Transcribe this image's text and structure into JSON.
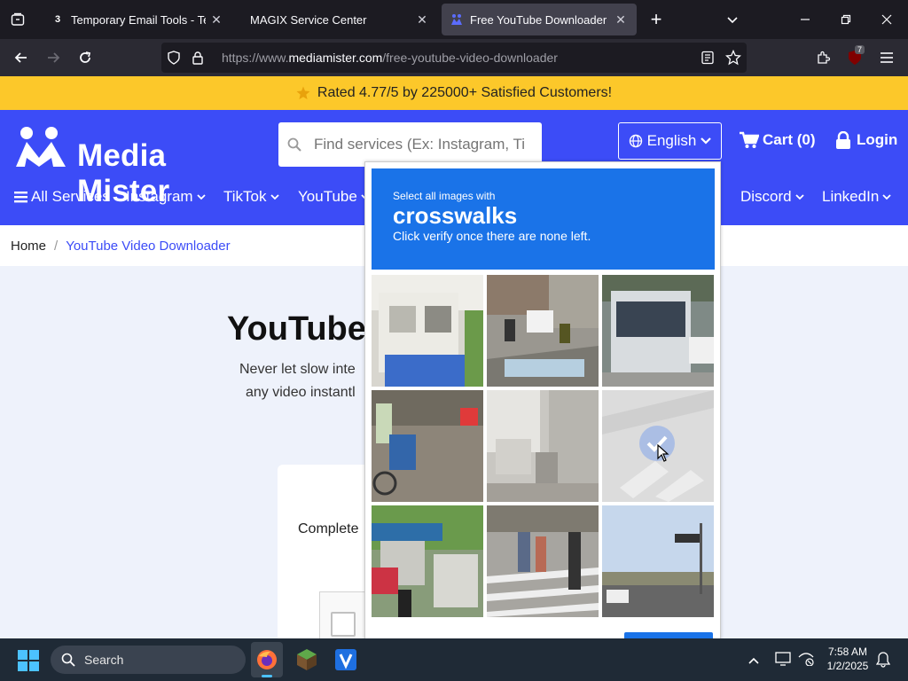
{
  "browser": {
    "tabs": [
      {
        "title": "Temporary Email Tools - Tempo",
        "favicon": "temp-mail-favicon",
        "active": false
      },
      {
        "title": "MAGIX Service Center",
        "favicon": "magix-favicon",
        "active": false
      },
      {
        "title": "Free YouTube Downloader | Do",
        "favicon": "mediamister-favicon",
        "active": true
      }
    ],
    "url_prefix": "https://www.",
    "url_host": "mediamister.com",
    "url_path": "/free-youtube-video-downloader",
    "extension_badge": "7"
  },
  "rating_banner": {
    "text": "Rated 4.77/5 by 225000+ Satisfied Customers!"
  },
  "header": {
    "logo_text": "Media Mister",
    "search_placeholder": "Find services (Ex: Instagram, Ti",
    "language": "English",
    "cart": "Cart (0)",
    "login": "Login"
  },
  "menu": {
    "all_services": "All Services",
    "items": [
      "Instagram",
      "TikTok",
      "YouTube",
      "Discord",
      "LinkedIn"
    ]
  },
  "breadcrumb": {
    "home": "Home",
    "separator": "/",
    "current": "YouTube Video Downloader"
  },
  "main": {
    "title_partial": "YouTube",
    "subtitle_line1": "Never let slow inte",
    "subtitle_line2": "any video instantl",
    "card_text": "Complete"
  },
  "captcha": {
    "instruction": "Select all images with",
    "target": "crosswalks",
    "hint": "Click verify once there are none left.",
    "tiles": [
      {
        "name": "building-balcony",
        "selected": false
      },
      {
        "name": "street-scooters",
        "selected": false
      },
      {
        "name": "city-bus",
        "selected": false
      },
      {
        "name": "sidewalk-cyclist",
        "selected": false
      },
      {
        "name": "parked-bikes",
        "selected": false
      },
      {
        "name": "crosswalk-faded",
        "selected": false
      },
      {
        "name": "street-market",
        "selected": false
      },
      {
        "name": "pedestrians-crosswalk",
        "selected": false
      },
      {
        "name": "traffic-light-road",
        "selected": false
      }
    ]
  },
  "taskbar": {
    "search_label": "Search",
    "time": "7:58 AM",
    "date": "1/2/2025"
  },
  "colors": {
    "brand_blue": "#3c4cf7",
    "banner_yellow": "#fcc82a",
    "captcha_blue": "#1a73e8"
  }
}
